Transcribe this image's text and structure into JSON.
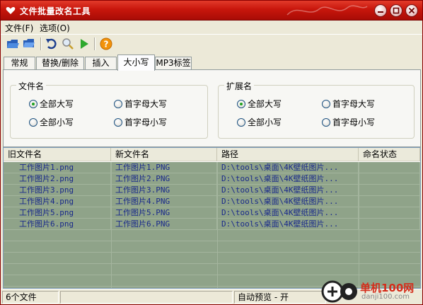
{
  "window": {
    "title": "文件批量改名工具"
  },
  "menu": [
    {
      "label": "文件(F)"
    },
    {
      "label": "选项(O)"
    }
  ],
  "toolbar": {
    "icons": [
      "open-folder-icon",
      "save-icon",
      "undo-icon",
      "preview-search-icon",
      "run-play-icon",
      "help-icon"
    ]
  },
  "tabs": [
    {
      "label": "常规",
      "active": false
    },
    {
      "label": "替换/删除",
      "active": false
    },
    {
      "label": "插入",
      "active": false
    },
    {
      "label": "大小写",
      "active": true
    },
    {
      "label": "MP3标签",
      "active": false
    }
  ],
  "case_panel": {
    "filename_group": {
      "title": "文件名",
      "options": [
        {
          "label": "全部大写",
          "selected": true
        },
        {
          "label": "首字母大写",
          "selected": false
        },
        {
          "label": "全部小写",
          "selected": false
        },
        {
          "label": "首字母小写",
          "selected": false
        }
      ]
    },
    "extension_group": {
      "title": "扩展名",
      "options": [
        {
          "label": "全部大写",
          "selected": true
        },
        {
          "label": "首字母大写",
          "selected": false
        },
        {
          "label": "全部小写",
          "selected": false
        },
        {
          "label": "首字母小写",
          "selected": false
        }
      ]
    }
  },
  "file_list": {
    "columns": [
      "旧文件名",
      "新文件名",
      "路径",
      "命名状态"
    ],
    "rows": [
      {
        "old": "工作图片1.png",
        "new": "工作图片1.PNG",
        "path": "D:\\tools\\桌面\\4K壁纸图片...",
        "status": ""
      },
      {
        "old": "工作图片2.png",
        "new": "工作图片2.PNG",
        "path": "D:\\tools\\桌面\\4K壁纸图片...",
        "status": ""
      },
      {
        "old": "工作图片3.png",
        "new": "工作图片3.PNG",
        "path": "D:\\tools\\桌面\\4K壁纸图片...",
        "status": ""
      },
      {
        "old": "工作图片4.png",
        "new": "工作图片4.PNG",
        "path": "D:\\tools\\桌面\\4K壁纸图片...",
        "status": ""
      },
      {
        "old": "工作图片5.png",
        "new": "工作图片5.PNG",
        "path": "D:\\tools\\桌面\\4K壁纸图片...",
        "status": ""
      },
      {
        "old": "工作图片6.png",
        "new": "工作图片6.PNG",
        "path": "D:\\tools\\桌面\\4K壁纸图片...",
        "status": ""
      }
    ]
  },
  "status": {
    "file_count": "6个文件",
    "empty_pane": "",
    "auto_preview": "自动预览 - 开"
  },
  "watermark": {
    "text": "单机100网",
    "sub": "danji100.com"
  },
  "colors": {
    "title_bar": "#c8160c",
    "list_bg": "#8fa389",
    "list_text": "#1a2a8a"
  }
}
